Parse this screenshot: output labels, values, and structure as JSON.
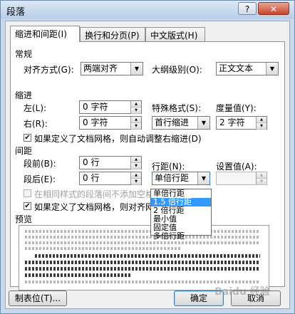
{
  "window": {
    "title": "段落",
    "help_glyph": "?",
    "close_glyph": "✕"
  },
  "tabs": [
    {
      "label": "缩进和间距(I)",
      "active": true
    },
    {
      "label": "换行和分页(P)",
      "active": false
    },
    {
      "label": "中文版式(H)",
      "active": false
    }
  ],
  "general": {
    "title": "常规",
    "alignment_label": "对齐方式(G):",
    "alignment_value": "两端对齐",
    "outline_label": "大纲级别(O):",
    "outline_value": "正文文本"
  },
  "indent": {
    "title": "缩进",
    "left_label": "左(L):",
    "left_value": "0 字符",
    "right_label": "右(R):",
    "right_value": "0 字符",
    "special_label": "特殊格式(S):",
    "special_value": "首行缩进",
    "by_label": "度量值(Y):",
    "by_value": "2 字符",
    "autoadjust_label": "如果定义了文档网格，则自动调整右缩进(D)",
    "autoadjust_checked": true
  },
  "spacing": {
    "title": "间距",
    "before_label": "段前(B):",
    "before_value": "0 行",
    "after_label": "段后(E):",
    "after_value": "0 行",
    "line_label": "行距(N):",
    "line_value": "单倍行距",
    "at_label": "设置值(A):",
    "at_value": "",
    "no_space_label": "在相同样式的段落间不添加空格",
    "no_space_checked": false,
    "snap_label": "如果定义了文档网格，则对齐网",
    "snap_checked": true
  },
  "line_spacing_options": [
    "单倍行距",
    "1.5 倍行距",
    "2 倍行距",
    "最小值",
    "固定值",
    "多倍行距"
  ],
  "line_spacing_highlighted": "1.5 倍行距",
  "preview": {
    "title": "预览"
  },
  "buttons": {
    "tabs": "制表位(T)...",
    "ok": "确定",
    "cancel": "取消"
  },
  "watermark": "Baidu 经验"
}
